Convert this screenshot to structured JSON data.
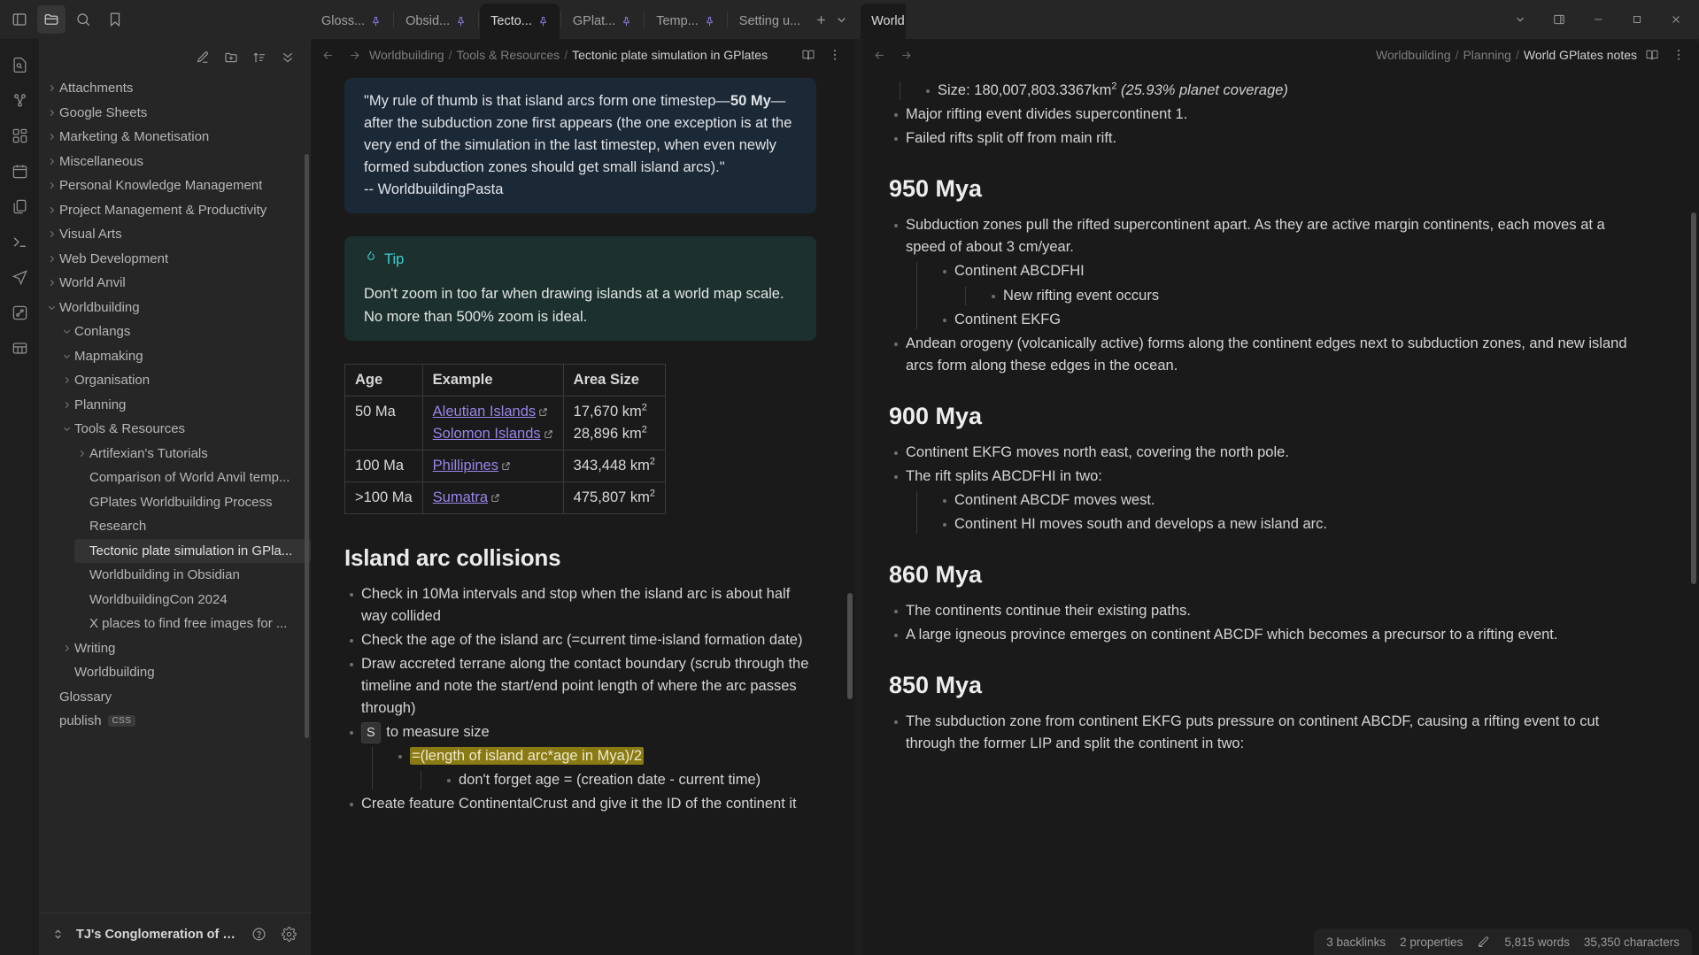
{
  "window": {
    "controls": {
      "minimize": "–",
      "maximize": "□",
      "close": "✕"
    }
  },
  "titlebar": {
    "left_icons": [
      {
        "name": "toggle-left-sidebar-icon",
        "label": "Toggle left sidebar"
      },
      {
        "name": "folder-icon",
        "label": "Files"
      },
      {
        "name": "search-icon",
        "label": "Search"
      },
      {
        "name": "bookmark-icon",
        "label": "Bookmarks"
      }
    ],
    "tabs_left": [
      {
        "label": "Gloss...",
        "pinned": true,
        "active": false
      },
      {
        "label": "Obsid...",
        "pinned": true,
        "active": false
      },
      {
        "label": "Tecto...",
        "pinned": true,
        "active": true
      },
      {
        "label": "GPlat...",
        "pinned": true,
        "active": false
      },
      {
        "label": "Temp...",
        "pinned": true,
        "active": false
      },
      {
        "label": "Setting u...",
        "pinned": false,
        "active": false
      }
    ],
    "new_tab_label": "+",
    "tab_list_label": "⌄",
    "tabs_right": [
      {
        "label": "World GPlates notes",
        "pinned": true,
        "active": true
      }
    ],
    "new_tab_right_label": "+"
  },
  "ribbon": {
    "items": [
      {
        "name": "file-search-icon",
        "label": "Quick switcher"
      },
      {
        "name": "graph-icon",
        "label": "Graph view"
      },
      {
        "name": "canvas-icon",
        "label": "Canvas"
      },
      {
        "name": "calendar-icon",
        "label": "Daily note"
      },
      {
        "name": "copy-files-icon",
        "label": "Templates"
      },
      {
        "name": "terminal-icon",
        "label": "Command palette"
      },
      {
        "name": "send-icon",
        "label": "Publish"
      },
      {
        "name": "shortcut-icon",
        "label": "Shortcuts"
      },
      {
        "name": "table-icon",
        "label": "Database"
      }
    ]
  },
  "sidebar": {
    "toolbar": [
      {
        "name": "new-note-icon",
        "label": "New note"
      },
      {
        "name": "new-folder-icon",
        "label": "New folder"
      },
      {
        "name": "sort-icon",
        "label": "Change sort order"
      },
      {
        "name": "collapse-all-icon",
        "label": "Collapse all"
      }
    ],
    "tree": [
      {
        "label": "Attachments",
        "depth": 0,
        "state": "collapsed",
        "selected": false
      },
      {
        "label": "Google Sheets",
        "depth": 0,
        "state": "collapsed",
        "selected": false
      },
      {
        "label": "Marketing & Monetisation",
        "depth": 0,
        "state": "collapsed",
        "selected": false
      },
      {
        "label": "Miscellaneous",
        "depth": 0,
        "state": "collapsed",
        "selected": false
      },
      {
        "label": "Personal Knowledge Management",
        "depth": 0,
        "state": "collapsed",
        "selected": false
      },
      {
        "label": "Project Management & Productivity",
        "depth": 0,
        "state": "collapsed",
        "selected": false
      },
      {
        "label": "Visual Arts",
        "depth": 0,
        "state": "collapsed",
        "selected": false
      },
      {
        "label": "Web Development",
        "depth": 0,
        "state": "collapsed",
        "selected": false
      },
      {
        "label": "World Anvil",
        "depth": 0,
        "state": "collapsed",
        "selected": false
      },
      {
        "label": "Worldbuilding",
        "depth": 0,
        "state": "expanded",
        "selected": false
      },
      {
        "label": "Conlangs",
        "depth": 1,
        "state": "expanded",
        "selected": false
      },
      {
        "label": "Mapmaking",
        "depth": 1,
        "state": "expanded",
        "selected": false
      },
      {
        "label": "Organisation",
        "depth": 1,
        "state": "collapsed",
        "selected": false
      },
      {
        "label": "Planning",
        "depth": 1,
        "state": "collapsed",
        "selected": false
      },
      {
        "label": "Tools & Resources",
        "depth": 1,
        "state": "expanded",
        "selected": false
      },
      {
        "label": "Artifexian's Tutorials",
        "depth": 2,
        "state": "collapsed",
        "selected": false
      },
      {
        "label": "Comparison of World Anvil temp...",
        "depth": 2,
        "state": "leaf",
        "selected": false
      },
      {
        "label": "GPlates Worldbuilding Process",
        "depth": 2,
        "state": "leaf",
        "selected": false
      },
      {
        "label": "Research",
        "depth": 2,
        "state": "leaf",
        "selected": false
      },
      {
        "label": "Tectonic plate simulation in GPla...",
        "depth": 2,
        "state": "leaf",
        "selected": true
      },
      {
        "label": "Worldbuilding in Obsidian",
        "depth": 2,
        "state": "leaf",
        "selected": false
      },
      {
        "label": "WorldbuildingCon 2024",
        "depth": 2,
        "state": "leaf",
        "selected": false
      },
      {
        "label": "X places to find free images for ...",
        "depth": 2,
        "state": "leaf",
        "selected": false
      },
      {
        "label": "Writing",
        "depth": 1,
        "state": "collapsed",
        "selected": false
      },
      {
        "label": "Worldbuilding",
        "depth": 1,
        "state": "leaf",
        "selected": false
      },
      {
        "label": "Glossary",
        "depth": 0,
        "state": "leaf",
        "selected": false
      },
      {
        "label": "publish",
        "depth": 0,
        "state": "leaf",
        "selected": false,
        "badge": "CSS"
      }
    ],
    "footer": {
      "vault_name": "TJ's Conglomeration of Learn...",
      "help_icon": "help-icon",
      "settings_icon": "gear-icon"
    }
  },
  "left_pane": {
    "breadcrumb": [
      "Worldbuilding",
      "Tools & Resources",
      "Tectonic plate simulation in GPlates"
    ],
    "header_icons": [
      {
        "name": "reading-view-icon",
        "label": "Reading view"
      },
      {
        "name": "more-options-icon",
        "label": "More options"
      }
    ],
    "quote_callout": {
      "text_part1": "\"My rule of thumb is that island arcs form one timestep—",
      "bold": "50 My",
      "text_part2": "—after the subduction zone first appears (the one exception is at the very end of the simulation in the last timestep, when even newly formed subduction zones should get small island arcs).\"",
      "attribution": "-- WorldbuildingPasta"
    },
    "tip_callout": {
      "icon": "flame-icon",
      "title": "Tip",
      "body": "Don't zoom in too far when drawing islands at a world map scale. No more than 500% zoom is ideal."
    },
    "table": {
      "headers": [
        "Age",
        "Example",
        "Area Size"
      ],
      "rows": [
        {
          "age": "50 Ma",
          "examples": [
            "Aleutian Islands",
            "Solomon Islands"
          ],
          "areas": [
            "17,670 km",
            "28,896 km"
          ]
        },
        {
          "age": "100 Ma",
          "examples": [
            "Phillipines"
          ],
          "areas": [
            "343,448 km"
          ]
        },
        {
          "age": ">100 Ma",
          "examples": [
            "Sumatra"
          ],
          "areas": [
            "475,807 km"
          ]
        }
      ],
      "area_exponent": "2"
    },
    "section_heading": "Island arc collisions",
    "bullets": [
      "Check in 10Ma intervals and stop when the island arc is about half way collided",
      "Check the age of the island arc (=current time-island formation date)",
      "Draw accreted terrane along the contact boundary (scrub through the timeline and note the start/end point length of where the arc passes through)"
    ],
    "measure_item": {
      "kbd": "S",
      "text": "to measure size"
    },
    "highlight_formula": "=(length of island arc*age in Mya)/2",
    "sub_note": "don't forget age = (creation date - current time)",
    "cut_off_bullet": "Create feature ContinentalCrust and give it the ID of the continent it"
  },
  "right_pane": {
    "breadcrumb": [
      "Worldbuilding",
      "Planning",
      "World GPlates notes"
    ],
    "header_icons": [
      {
        "name": "reading-view-icon",
        "label": "Reading view"
      },
      {
        "name": "more-options-icon",
        "label": "More options"
      }
    ],
    "top_bullets": [
      {
        "text": "Size: 180,007,803.3367km",
        "sup": "2",
        "em": " (25.93% planet coverage)",
        "indent": 1
      },
      {
        "text": "Major rifting event divides supercontinent 1.",
        "indent": 0
      },
      {
        "text": "Failed rifts split off from main rift.",
        "indent": 0
      }
    ],
    "sections": [
      {
        "heading": "950 Mya",
        "items": [
          {
            "text": "Subduction zones pull the rifted supercontinent apart. As they are active margin continents, each moves at a speed of about 3 cm/year.",
            "indent": 0
          },
          {
            "text": "Continent ABCDFHI",
            "indent": 1
          },
          {
            "text": "New rifting event occurs",
            "indent": 2
          },
          {
            "text": "Continent EKFG",
            "indent": 1
          },
          {
            "text": "Andean orogeny (volcanically active) forms along the continent edges next to subduction zones, and new island arcs form along these edges in the ocean.",
            "indent": 0
          }
        ]
      },
      {
        "heading": "900 Mya",
        "items": [
          {
            "text": "Continent EKFG moves north east, covering the north pole.",
            "indent": 0
          },
          {
            "text": "The rift splits ABCDFHI in two:",
            "indent": 0
          },
          {
            "text": "Continent ABCDF moves west.",
            "indent": 1
          },
          {
            "text": "Continent HI moves south and develops a new island arc.",
            "indent": 1
          }
        ]
      },
      {
        "heading": "860 Mya",
        "items": [
          {
            "text": "The continents continue their existing paths.",
            "indent": 0
          },
          {
            "text": "A large igneous province emerges on continent ABCDF which becomes a precursor to a rifting event.",
            "indent": 0
          }
        ]
      },
      {
        "heading": "850 Mya",
        "items": [
          {
            "text": "The subduction zone from continent EKFG puts pressure on continent ABCDF, causing a rifting event to cut through the former LIP and split the continent in two:",
            "indent": 0
          }
        ]
      }
    ]
  },
  "statusbar": {
    "backlinks": "3 backlinks",
    "properties": "2 properties",
    "edit_icon": "pencil-icon",
    "words": "5,815 words",
    "characters": "35,350 characters"
  },
  "colors": {
    "accent": "#8b7ae0",
    "quote_callout_bg": "#1b2835",
    "tip_callout_bg": "#1c302e",
    "tip_title": "#3ecfcf",
    "highlight": "#8a7a13",
    "link": "#9a84e8"
  }
}
